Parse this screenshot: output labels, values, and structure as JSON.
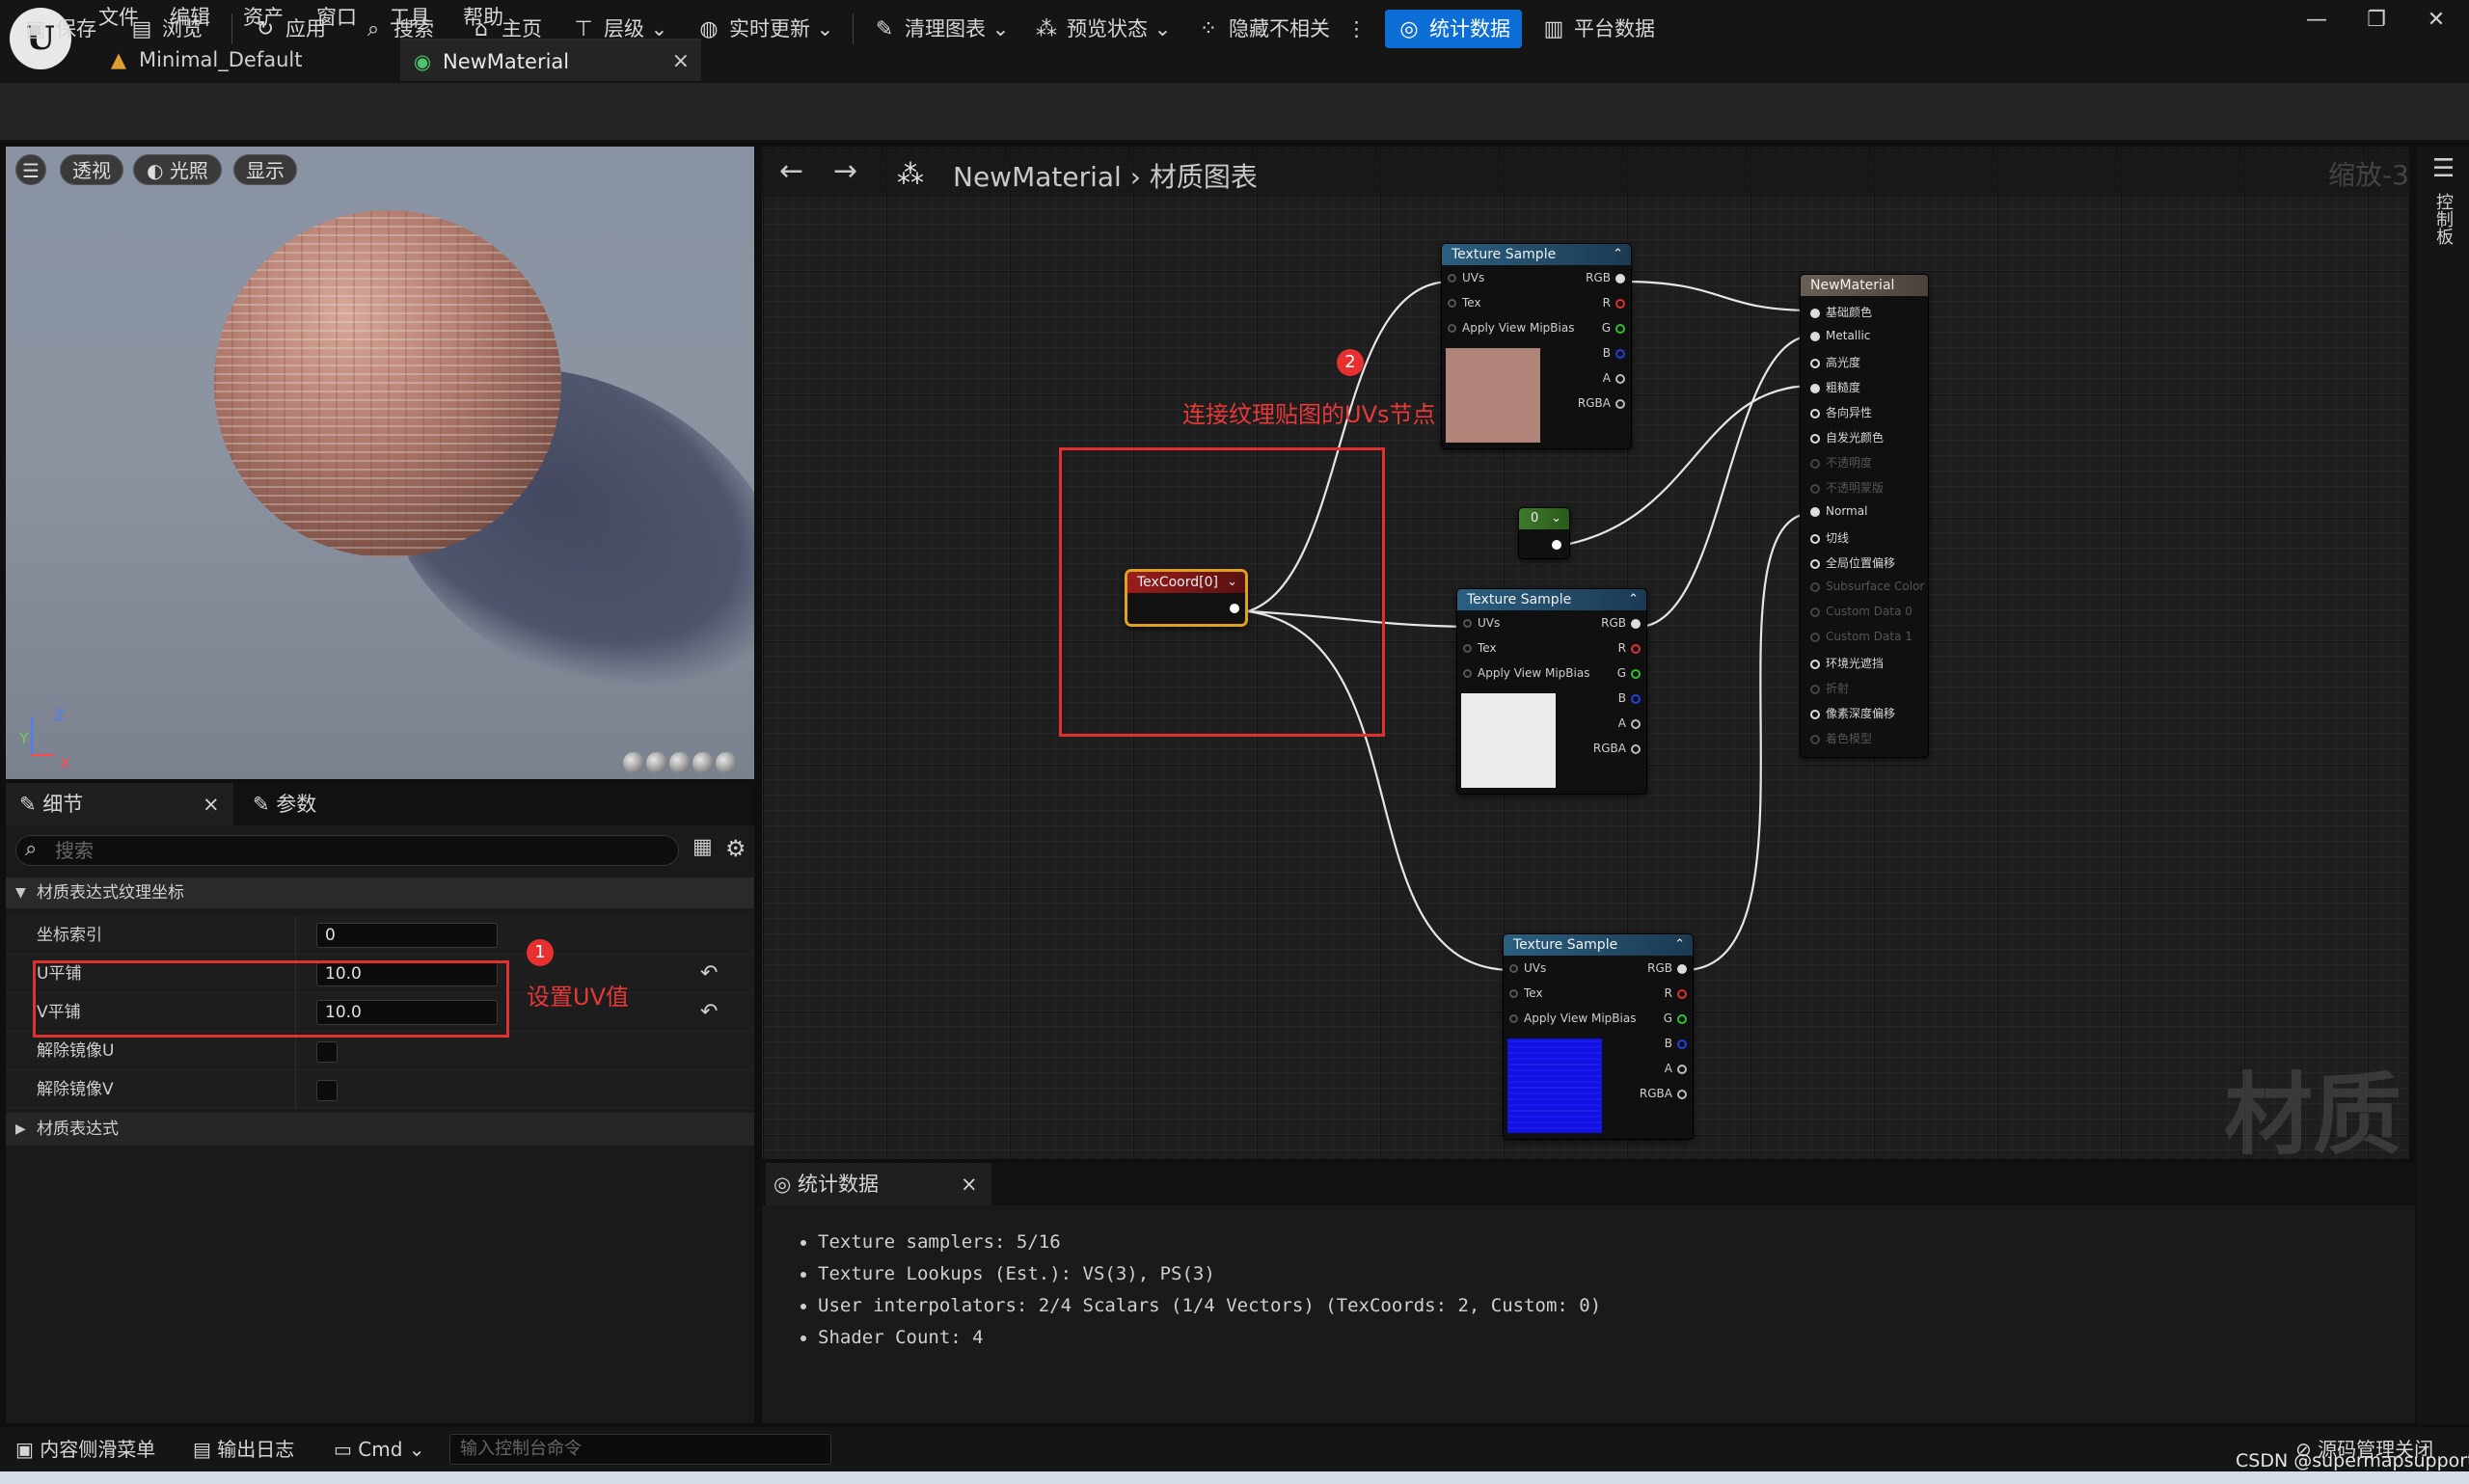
{
  "titlebar": {
    "menu": [
      "文件",
      "编辑",
      "资产",
      "窗口",
      "工具",
      "帮助"
    ],
    "tabs": [
      {
        "label": "Minimal_Default",
        "icon": "level-icon"
      },
      {
        "label": "NewMaterial",
        "icon": "material-icon",
        "close": "×"
      }
    ],
    "window_buttons": [
      "—",
      "❐",
      "✕"
    ]
  },
  "toolbar": {
    "save": "保存",
    "browse": "浏览",
    "apply": "应用",
    "search": "搜索",
    "home": "主页",
    "hierarchy": "层级",
    "live_update": "实时更新",
    "clean_graph": "清理图表",
    "preview_state": "预览状态",
    "hide_unrelated": "隐藏不相关",
    "stats": "统计数据",
    "platform_stats": "平台数据"
  },
  "viewport": {
    "perspective": "透视",
    "lit": "光照",
    "show": "显示",
    "menu_icon": "hamburger-icon"
  },
  "details": {
    "tab_details": "细节",
    "tab_params": "参数",
    "close": "×",
    "search_placeholder": "搜索",
    "category": "材质表达式纹理坐标",
    "rows": [
      {
        "label": "坐标索引",
        "value": "0"
      },
      {
        "label": "U平铺",
        "value": "10.0"
      },
      {
        "label": "V平铺",
        "value": "10.0"
      },
      {
        "label": "解除镜像U"
      },
      {
        "label": "解除镜像V"
      }
    ],
    "category2": "材质表达式"
  },
  "graph": {
    "breadcrumb_asset": "NewMaterial",
    "breadcrumb_sep": "›",
    "breadcrumb_graph": "材质图表",
    "zoom": "缩放-3",
    "watermark": "材质",
    "right_strip": "控制板",
    "texture_sample": {
      "title": "Texture Sample",
      "inputs": [
        "UVs",
        "Tex",
        "Apply View MipBias"
      ],
      "outputs": [
        "RGB",
        "R",
        "G",
        "B",
        "A",
        "RGBA"
      ]
    },
    "texcoord": {
      "title": "TexCoord[0]"
    },
    "constant": {
      "title": "0"
    },
    "result": {
      "title": "NewMaterial",
      "pins": [
        "基础颜色",
        "Metallic",
        "高光度",
        "粗糙度",
        "各向异性",
        "自发光颜色",
        "不透明度",
        "不透明蒙版",
        "Normal",
        "切线",
        "全局位置偏移",
        "Subsurface Color",
        "Custom Data 0",
        "Custom Data 1",
        "环境光遮挡",
        "折射",
        "像素深度偏移",
        "着色模型"
      ]
    },
    "swatch_colors": [
      "#b08478",
      "#ececec",
      "#1212e0"
    ]
  },
  "annotations": {
    "badge1": "1",
    "text1": "设置UV值",
    "badge2": "2",
    "text2": "连接纹理贴图的UVs节点",
    "color": "#e83030"
  },
  "stats": {
    "tab": "统计数据",
    "close": "×",
    "lines": [
      "Texture samplers: 5/16",
      "Texture Lookups (Est.): VS(3), PS(3)",
      "User interpolators: 2/4 Scalars (1/4 Vectors) (TexCoords: 2, Custom: 0)",
      "Shader Count: 4"
    ]
  },
  "statusbar": {
    "content_drawer": "内容侧滑菜单",
    "output_log": "输出日志",
    "cmd": "Cmd",
    "console_placeholder": "输入控制台命令",
    "source_control": "源码管理关闭",
    "credit": "CSDN @supermapsupport"
  }
}
